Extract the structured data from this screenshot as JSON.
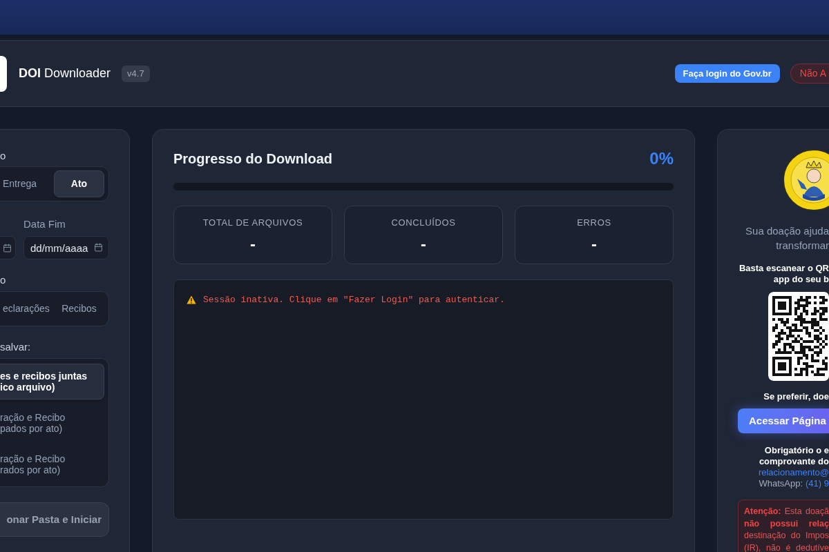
{
  "header": {
    "title": "**DOI** Downloader",
    "version": "v4.7",
    "login_button": "Faça login do Gov.br",
    "status_badge": "Não A"
  },
  "filters": {
    "date_type": {
      "label": "o",
      "options": [
        {
          "label": "Entrega",
          "selected": false
        },
        {
          "label": "Ato",
          "selected": true
        }
      ]
    },
    "dates": {
      "end_label": "Data Fim",
      "end_placeholder": "dd/mm/aaaa"
    },
    "doc_type": {
      "label": "o",
      "options": [
        {
          "label": "eclarações",
          "selected": false
        },
        {
          "label": "Recibos",
          "selected": false
        }
      ]
    },
    "save_mode": {
      "label": "salvar:",
      "options": [
        {
          "lines": [
            "es e recibos juntas",
            "ico arquivo)"
          ],
          "selected": true
        },
        {
          "lines": [
            "ração e Recibo",
            "pados por ato)"
          ],
          "selected": false
        },
        {
          "lines": [
            "ração e Recibo",
            "rados por ato)"
          ],
          "selected": false
        }
      ]
    },
    "start_button": "onar Pasta e Iniciar"
  },
  "progress": {
    "title": "Progresso do Download",
    "percent": "0%",
    "level": 0,
    "stats": [
      {
        "label": "TOTAL DE ARQUIVOS",
        "value": "-"
      },
      {
        "label": "CONCLUÍDOS",
        "value": "-"
      },
      {
        "label": "ERROS",
        "value": "-"
      }
    ],
    "log": [
      {
        "kind": "warning",
        "text": "Sessão inativa. Clique em \"Fazer Login\" para autenticar."
      }
    ]
  },
  "donation": {
    "message": [
      "Sua doação ajuda",
      "transformar"
    ],
    "instructions": [
      "Basta escanear o QR",
      "app do seu b"
    ],
    "alternative": "Se preferir, doe",
    "page_button": "Acessar Página",
    "requirement": [
      "Obrigatório o e",
      "comprovante do"
    ],
    "email": "relacionamento@",
    "whatsapp_label": "WhatsApp:",
    "whatsapp_number": "(41) 9",
    "attention": [
      "**Atenção:** Esta doaçã",
      "**não possui relaç**",
      "destinação do Impos",
      "(IR), não é dedutíve"
    ]
  }
}
